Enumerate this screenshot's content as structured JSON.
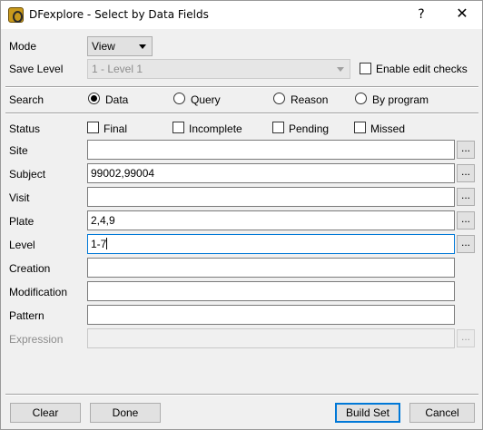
{
  "window": {
    "title": "DFexplore - Select by Data Fields",
    "help_label": "?",
    "close_label": "✕"
  },
  "mode": {
    "label": "Mode",
    "value": "View"
  },
  "save_level": {
    "label": "Save Level",
    "value": "1 - Level 1",
    "enable_edit_checks_label": "Enable edit checks",
    "enable_edit_checks_checked": false
  },
  "search": {
    "label": "Search",
    "options": [
      {
        "label": "Data",
        "selected": true
      },
      {
        "label": "Query",
        "selected": false
      },
      {
        "label": "Reason",
        "selected": false
      },
      {
        "label": "By program",
        "selected": false
      }
    ]
  },
  "status": {
    "label": "Status",
    "options": [
      {
        "label": "Final",
        "checked": false
      },
      {
        "label": "Incomplete",
        "checked": false
      },
      {
        "label": "Pending",
        "checked": false
      },
      {
        "label": "Missed",
        "checked": false
      }
    ]
  },
  "fields": {
    "site": {
      "label": "Site",
      "value": ""
    },
    "subject": {
      "label": "Subject",
      "value": "99002,99004"
    },
    "visit": {
      "label": "Visit",
      "value": ""
    },
    "plate": {
      "label": "Plate",
      "value": "2,4,9"
    },
    "level": {
      "label": "Level",
      "value": "1-7"
    },
    "creation": {
      "label": "Creation",
      "value": ""
    },
    "modification": {
      "label": "Modification",
      "value": ""
    },
    "pattern": {
      "label": "Pattern",
      "value": ""
    },
    "expression": {
      "label": "Expression",
      "value": ""
    }
  },
  "browse_label": "...",
  "buttons": {
    "clear": "Clear",
    "done": "Done",
    "build_set": "Build Set",
    "cancel": "Cancel"
  },
  "colors": {
    "focus_border": "#0078d7",
    "app_icon": "#c99a1c"
  },
  "icons": {
    "app": "dfexplore-app-icon",
    "close": "close-icon",
    "help": "help-icon"
  }
}
